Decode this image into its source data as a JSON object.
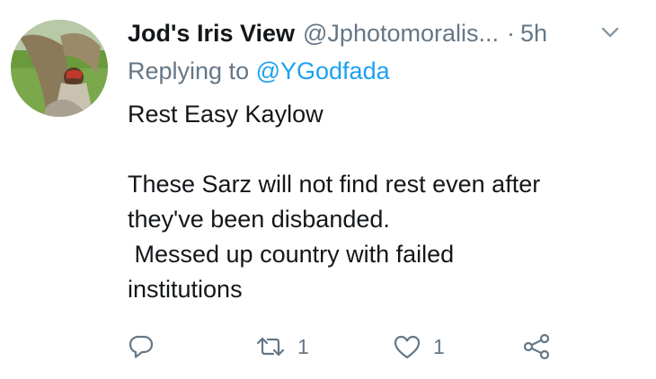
{
  "tweet": {
    "display_name": "Jod's Iris View",
    "handle": "@Jphotomoralis...",
    "separator": "·",
    "time": "5h",
    "replying_prefix": "Replying to",
    "replying_to": "@YGodfada",
    "body_lines": [
      "Rest Easy Kaylow",
      "",
      "These Sarz will not find rest even after",
      "they've been disbanded.",
      " Messed up country with failed",
      "institutions"
    ],
    "retweet_count": "1",
    "like_count": "1"
  },
  "icons": {
    "reply": "reply-icon",
    "retweet": "retweet-icon",
    "like": "heart-icon",
    "share": "share-icon",
    "menu": "chevron-down-icon"
  },
  "colors": {
    "secondary_text": "#657786",
    "link": "#1da1f2",
    "primary_text": "#14171a"
  }
}
